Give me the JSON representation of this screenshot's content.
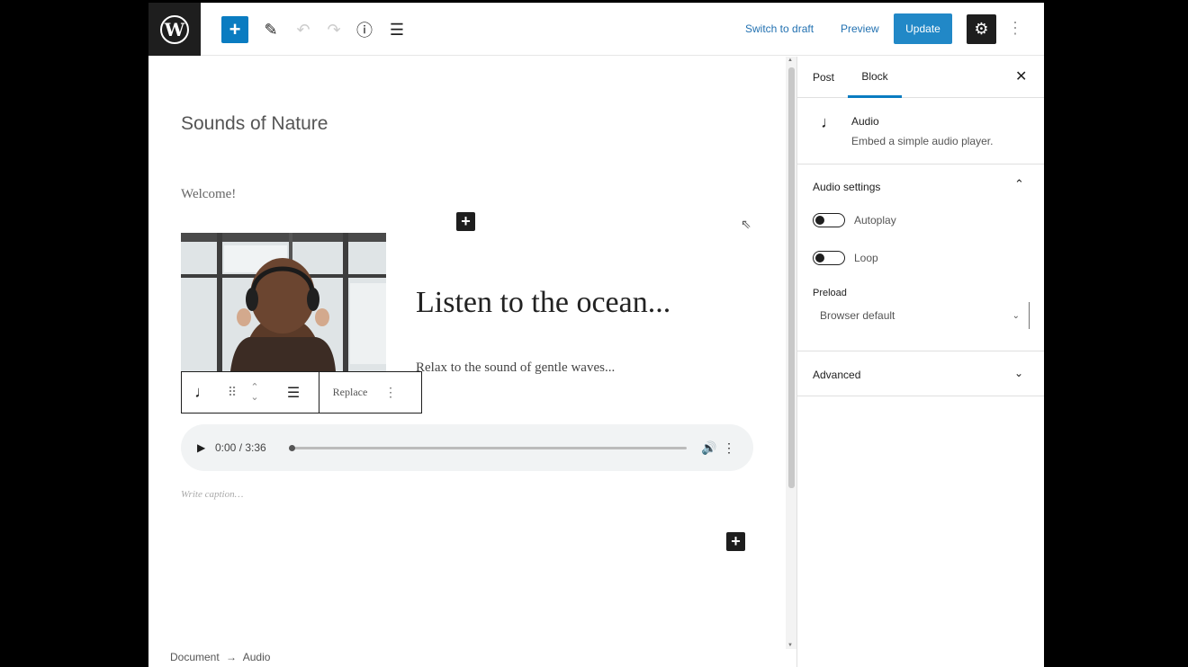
{
  "topbar": {
    "logo_letter": "W",
    "add_symbol": "+",
    "pen_symbol": "✎",
    "undo_symbol": "↶",
    "redo_symbol": "↷",
    "info_symbol": "ⓘ",
    "list_symbol": "☰",
    "switch_to_draft": "Switch to draft",
    "preview": "Preview",
    "update": "Update",
    "settings_symbol": "⚙",
    "more_symbol": "⋮"
  },
  "editor": {
    "post_title": "Sounds of Nature",
    "welcome": "Welcome!",
    "inserter_symbol": "+",
    "cursor_symbol": "⇖",
    "media_heading": "Listen to the ocean...",
    "media_paragraph": "Relax to the sound of gentle waves...",
    "block_toolbar": {
      "audio_icon": "♩",
      "drag_icon": "⠿",
      "move_up": "⌃",
      "move_down": "⌄",
      "align_icon": "☰",
      "replace": "Replace",
      "more": "⋮"
    },
    "audio_player": {
      "play_symbol": "▶",
      "time": "0:00 / 3:36",
      "progress": 0,
      "volume_symbol": "🔊",
      "more_symbol": "⋮"
    },
    "caption_placeholder": "Write caption…",
    "breadcrumb": [
      "Document",
      "→",
      "Audio"
    ]
  },
  "sidebar": {
    "tabs": [
      {
        "label": "Post",
        "active": false
      },
      {
        "label": "Block",
        "active": true
      }
    ],
    "close_symbol": "✕",
    "block_card": {
      "icon": "♩",
      "title": "Audio",
      "description": "Embed a simple audio player."
    },
    "audio_settings": {
      "title": "Audio settings",
      "chevron": "⌃",
      "autoplay_label": "Autoplay",
      "autoplay_on": false,
      "loop_label": "Loop",
      "loop_on": false,
      "preload_label": "Preload",
      "preload_value": "Browser default",
      "preload_caret": "⌄"
    },
    "advanced": {
      "title": "Advanced",
      "chevron": "⌄"
    }
  },
  "colors": {
    "accent": "#0a7cc1",
    "dark": "#1e1e1e",
    "frame": "#000000"
  }
}
